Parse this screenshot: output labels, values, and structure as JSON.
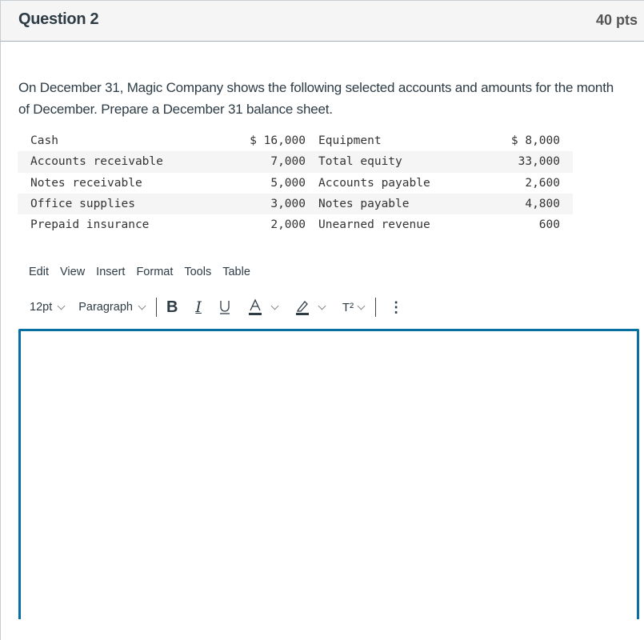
{
  "header": {
    "title": "Question 2",
    "points": "40 pts"
  },
  "prompt": {
    "text": "On December 31, Magic Company shows the following selected accounts and amounts for the month of December. Prepare a December 31 balance sheet."
  },
  "accounts": [
    {
      "left_name": "Cash",
      "left_amount": "$ 16,000",
      "right_name": "Equipment",
      "right_amount": "$ 8,000"
    },
    {
      "left_name": "Accounts receivable",
      "left_amount": "7,000",
      "right_name": "Total equity",
      "right_amount": "33,000"
    },
    {
      "left_name": "Notes receivable",
      "left_amount": "5,000",
      "right_name": "Accounts payable",
      "right_amount": "2,600"
    },
    {
      "left_name": "Office supplies",
      "left_amount": "3,000",
      "right_name": "Notes payable",
      "right_amount": "4,800"
    },
    {
      "left_name": "Prepaid insurance",
      "left_amount": "2,000",
      "right_name": "Unearned revenue",
      "right_amount": "600"
    }
  ],
  "editor": {
    "menu": [
      "Edit",
      "View",
      "Insert",
      "Format",
      "Tools",
      "Table"
    ],
    "font_size": "12pt",
    "block_format": "Paragraph",
    "buttons": {
      "bold": "B",
      "italic": "I",
      "underline": "U",
      "text_color": "A",
      "superscript": "T²",
      "more": "⋮"
    },
    "content": "",
    "accent_color": "#0770a3"
  }
}
